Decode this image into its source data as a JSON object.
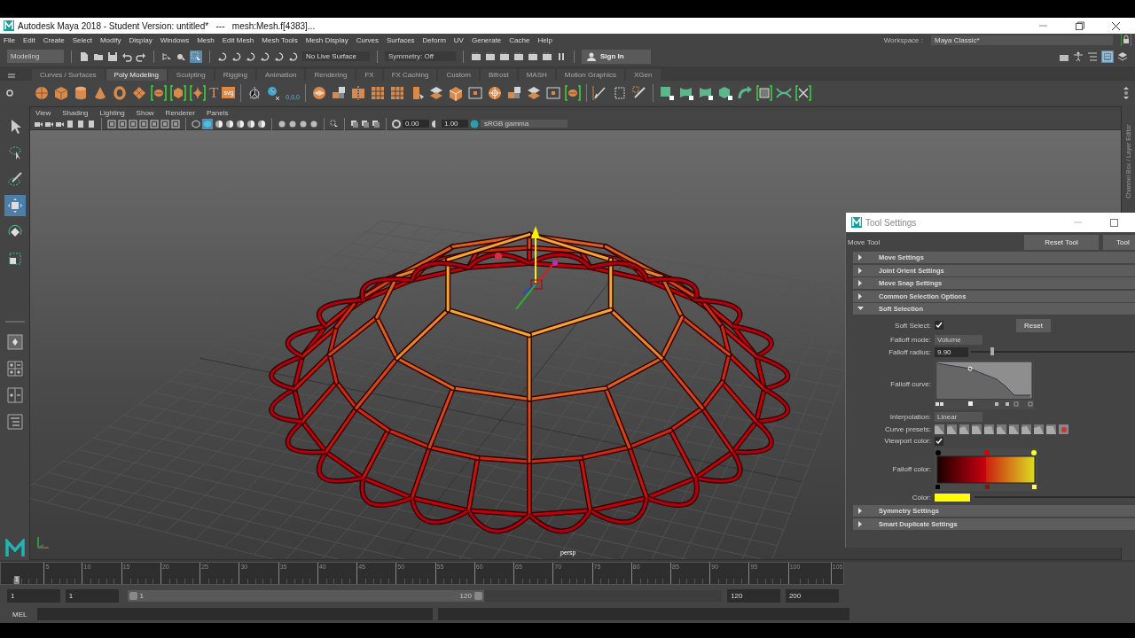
{
  "window": {
    "title": "Autodesk Maya 2018 - Student Version: untitled*   ---   mesh:Mesh.f[4383]..."
  },
  "menu_bar": [
    "File",
    "Edit",
    "Create",
    "Select",
    "Modify",
    "Display",
    "Windows",
    "Mesh",
    "Edit Mesh",
    "Mesh Tools",
    "Mesh Display",
    "Curves",
    "Surfaces",
    "Deform",
    "UV",
    "Generate",
    "Cache",
    "Help"
  ],
  "workspace": {
    "label": "Workspace :",
    "value": "Maya Classic*"
  },
  "status_line": {
    "menu_set": "Modeling",
    "live_surface": "No Live Surface",
    "symmetry": "Symmetry: Off",
    "sign_in": "Sign In"
  },
  "shelf_tabs": [
    {
      "label": "Curves / Surfaces",
      "selected": false
    },
    {
      "label": "Poly Modeling",
      "selected": true
    },
    {
      "label": "Sculpting",
      "selected": false
    },
    {
      "label": "Rigging",
      "selected": false
    },
    {
      "label": "Animation",
      "selected": false
    },
    {
      "label": "Rendering",
      "selected": false
    },
    {
      "label": "FX",
      "selected": false
    },
    {
      "label": "FX Caching",
      "selected": false
    },
    {
      "label": "Custom",
      "selected": false
    },
    {
      "label": "Bifrost",
      "selected": false
    },
    {
      "label": "MASH",
      "selected": false
    },
    {
      "label": "Motion Graphics",
      "selected": false
    },
    {
      "label": "XGen",
      "selected": false
    }
  ],
  "shelf_labels": [
    "T",
    "svg",
    "0,0,0"
  ],
  "viewport": {
    "menus": [
      "View",
      "Shading",
      "Lighting",
      "Show",
      "Renderer",
      "Panels"
    ],
    "exposure": "0.00",
    "gamma": "1.00",
    "color_space": "sRGB gamma",
    "camera": "persp"
  },
  "side_tab": "Channel Box / Layer Editor",
  "tool_settings": {
    "title": "Tool Settings",
    "tool_name": "Move Tool",
    "buttons": [
      "Reset Tool",
      "Tool"
    ],
    "sections": [
      {
        "label": "Move Settings",
        "expanded": false
      },
      {
        "label": "Joint Orient Settings",
        "expanded": false
      },
      {
        "label": "Move Snap Settings",
        "expanded": false
      },
      {
        "label": "Common Selection Options",
        "expanded": false
      },
      {
        "label": "Soft Selection",
        "expanded": true,
        "fields": [
          {
            "kind": "checkbox",
            "label": "Soft Select:",
            "checked": true,
            "button": "Reset"
          },
          {
            "kind": "dropdown",
            "label": "Falloff mode:",
            "value": "Volume"
          },
          {
            "kind": "slider",
            "label": "Falloff radius:",
            "value": "9.90",
            "level": 0.12
          },
          {
            "kind": "curve",
            "label": "Falloff curve:"
          },
          {
            "kind": "dropdown",
            "label": "Interpolation:",
            "value": "Linear"
          },
          {
            "kind": "presets",
            "label": "Curve presets:"
          },
          {
            "kind": "checkbox",
            "label": "Viewport color:",
            "checked": true
          },
          {
            "kind": "ramp",
            "label": "Falloff color:"
          },
          {
            "kind": "color",
            "label": "Color:"
          }
        ]
      },
      {
        "label": "Symmetry Settings",
        "expanded": false
      },
      {
        "label": "Smart Duplicate Settings",
        "expanded": false
      }
    ]
  },
  "timeline": {
    "current_frame": "1",
    "labels": [
      "5",
      "10",
      "15",
      "20",
      "25",
      "30",
      "35",
      "40",
      "45",
      "50",
      "55",
      "60",
      "65",
      "70",
      "75",
      "80",
      "85",
      "90",
      "95",
      "100",
      "105"
    ]
  },
  "range": {
    "level": 0.6,
    "start": "1",
    "playback_start": "1",
    "slider_start": "1",
    "slider_end": "120",
    "playback_end": "120",
    "end": "200"
  },
  "command_line": {
    "language": "MEL"
  }
}
